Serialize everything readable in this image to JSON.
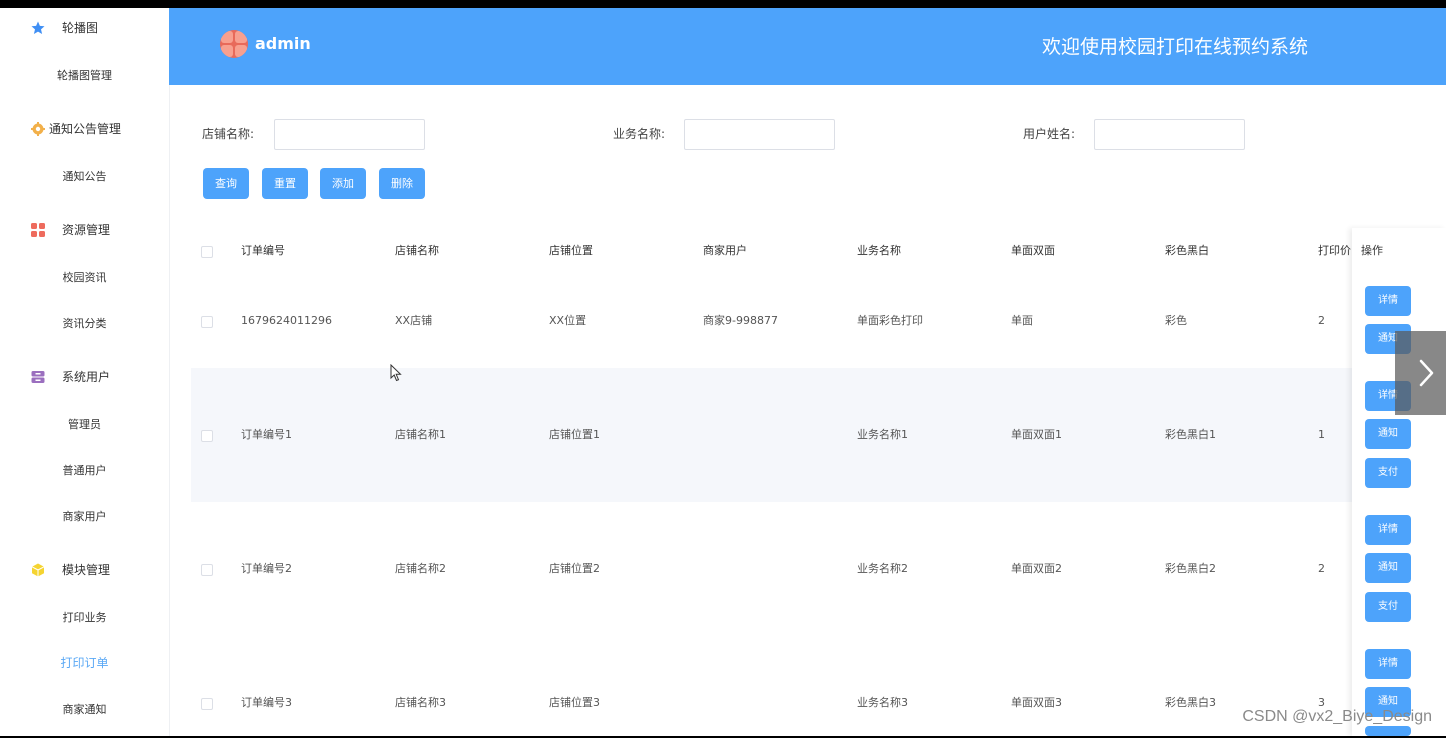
{
  "header": {
    "user": "admin",
    "title": "欢迎使用校园打印在线预约系统"
  },
  "sidebar": {
    "groups": [
      {
        "label": "轮播图",
        "icon": "star-icon",
        "items": [
          "轮播图管理"
        ]
      },
      {
        "label": "通知公告管理",
        "icon": "gear-icon",
        "items": [
          "通知公告"
        ]
      },
      {
        "label": "资源管理",
        "icon": "grid-icon",
        "items": [
          "校园资讯",
          "资讯分类"
        ]
      },
      {
        "label": "系统用户",
        "icon": "user-box-icon",
        "items": [
          "管理员",
          "普通用户",
          "商家用户"
        ]
      },
      {
        "label": "模块管理",
        "icon": "cube-icon",
        "items": [
          "打印业务",
          "打印订单",
          "商家通知"
        ]
      }
    ],
    "active_item": "打印订单"
  },
  "search": {
    "shop_name_label": "店铺名称:",
    "service_name_label": "业务名称:",
    "user_name_label": "用户姓名:",
    "query_btn": "查询",
    "reset_btn": "重置",
    "add_btn": "添加",
    "delete_btn": "删除"
  },
  "table": {
    "columns": [
      "订单编号",
      "店铺名称",
      "店铺位置",
      "商家用户",
      "业务名称",
      "单面双面",
      "彩色黑白",
      "打印价",
      "操作"
    ],
    "rows": [
      {
        "order_no": "1679624011296",
        "shop_name": "XX店铺",
        "shop_location": "XX位置",
        "merchant": "商家9-998877",
        "service": "单面彩色打印",
        "sides": "单面",
        "color": "彩色",
        "price": "2"
      },
      {
        "order_no": "订单编号1",
        "shop_name": "店铺名称1",
        "shop_location": "店铺位置1",
        "merchant": "",
        "service": "业务名称1",
        "sides": "单面双面1",
        "color": "彩色黑白1",
        "price": "1"
      },
      {
        "order_no": "订单编号2",
        "shop_name": "店铺名称2",
        "shop_location": "店铺位置2",
        "merchant": "",
        "service": "业务名称2",
        "sides": "单面双面2",
        "color": "彩色黑白2",
        "price": "2"
      },
      {
        "order_no": "订单编号3",
        "shop_name": "店铺名称3",
        "shop_location": "店铺位置3",
        "merchant": "",
        "service": "业务名称3",
        "sides": "单面双面3",
        "color": "彩色黑白3",
        "price": "3"
      }
    ],
    "actions": {
      "detail": "详情",
      "notify": "通知",
      "pay": "支付"
    }
  },
  "watermark": "CSDN @vx2_Biye_Design",
  "colors": {
    "primary": "#4da3fb",
    "active_menu": "#5aa8f5",
    "row_stripe": "#f5f7fb"
  }
}
